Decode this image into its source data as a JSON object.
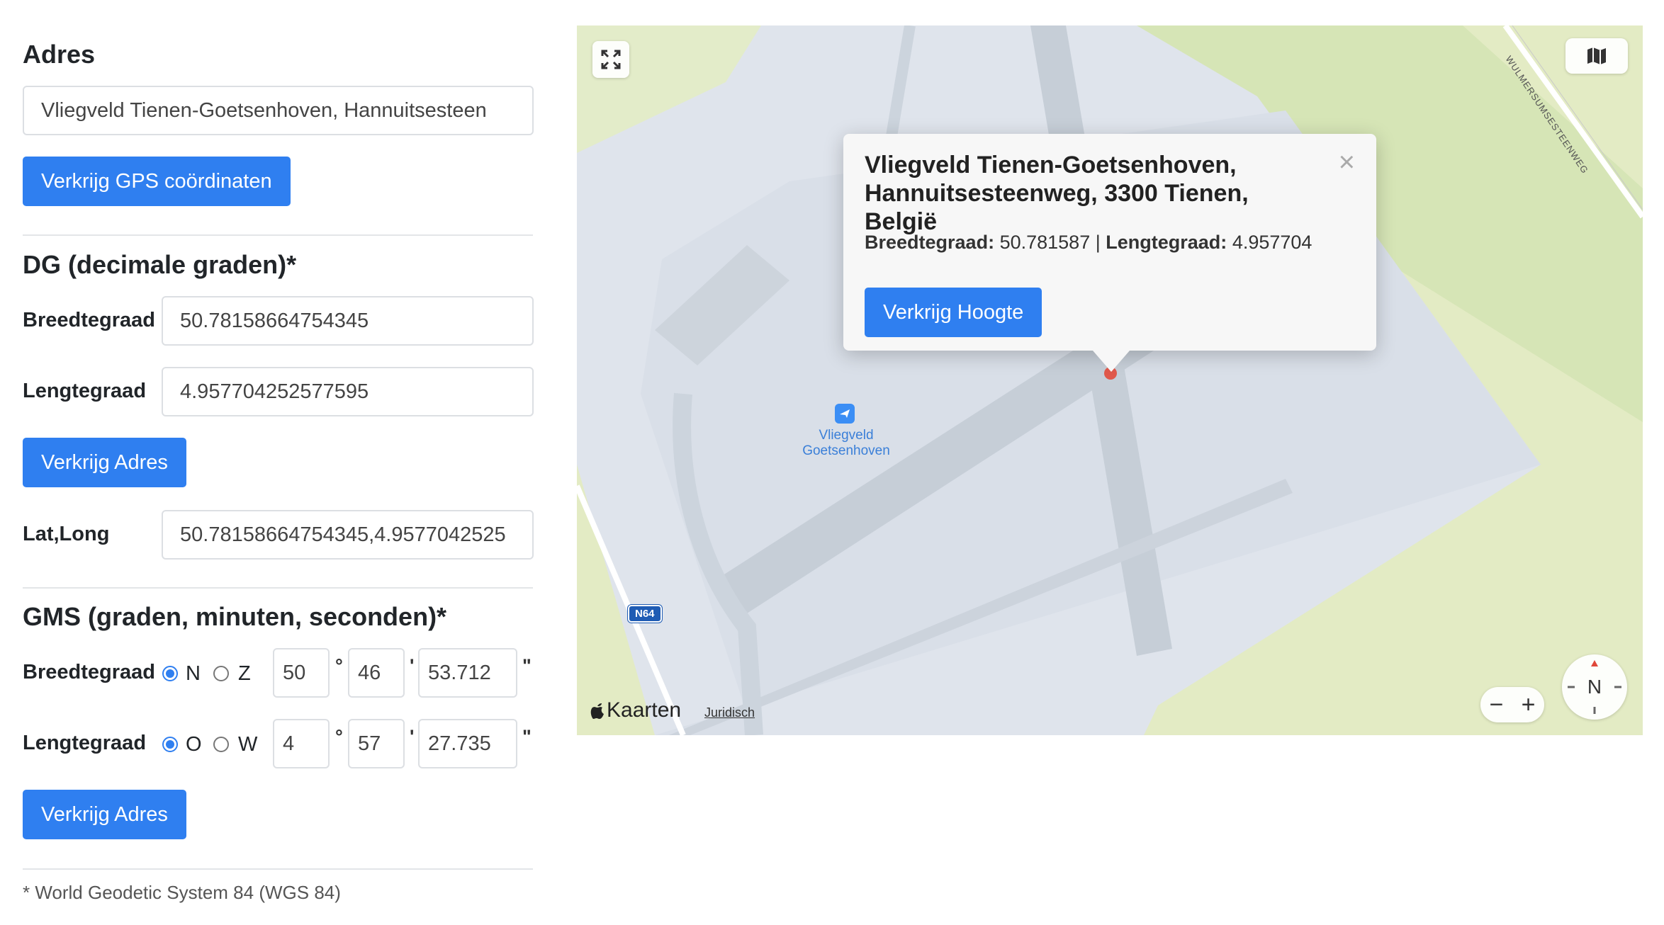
{
  "address": {
    "heading": "Adres",
    "input_value": "Vliegveld Tienen-Goetsenhoven, Hannuitsesteen",
    "button": "Verkrijg GPS coördinaten"
  },
  "dd": {
    "heading": "DG (decimale graden)*",
    "lat_label": "Breedtegraad",
    "lat_value": "50.78158664754345",
    "lng_label": "Lengtegraad",
    "lng_value": "4.957704252577595",
    "button": "Verkrijg Adres",
    "latlong_label": "Lat,Long",
    "latlong_value": "50.78158664754345,4.9577042525"
  },
  "dms": {
    "heading": "GMS (graden, minuten, seconden)*",
    "lat_label": "Breedtegraad",
    "lat_dir_1": "N",
    "lat_dir_2": "Z",
    "lat_deg": "50",
    "lat_min": "46",
    "lat_sec": "53.712",
    "lng_label": "Lengtegraad",
    "lng_dir_1": "O",
    "lng_dir_2": "W",
    "lng_deg": "4",
    "lng_min": "57",
    "lng_sec": "27.735",
    "deg_symbol": "°",
    "min_symbol": "'",
    "sec_symbol": "\"",
    "button": "Verkrijg Adres"
  },
  "footnote": "* World Geodetic System 84 (WGS 84)",
  "map": {
    "popup_title": "Vliegveld Tienen-Goetsenhoven, Hannuitsesteenweg, 3300 Tienen, België",
    "popup_lat_label": "Breedtegraad:",
    "popup_lat_value": "50.781587",
    "popup_separator": "|",
    "popup_lng_label": "Lengtegraad:",
    "popup_lng_value": "4.957704",
    "popup_button": "Verkrijg Hoogte",
    "close_symbol": "×",
    "poi_label_line1": "Vliegveld",
    "poi_label_line2": "Goetsenhoven",
    "road_shield": "N64",
    "road_name": "WULMERSUMSESTEENWEG",
    "brand": "Kaarten",
    "legal": "Juridisch",
    "zoom_out": "−",
    "zoom_in": "+",
    "compass_letter": "N"
  }
}
